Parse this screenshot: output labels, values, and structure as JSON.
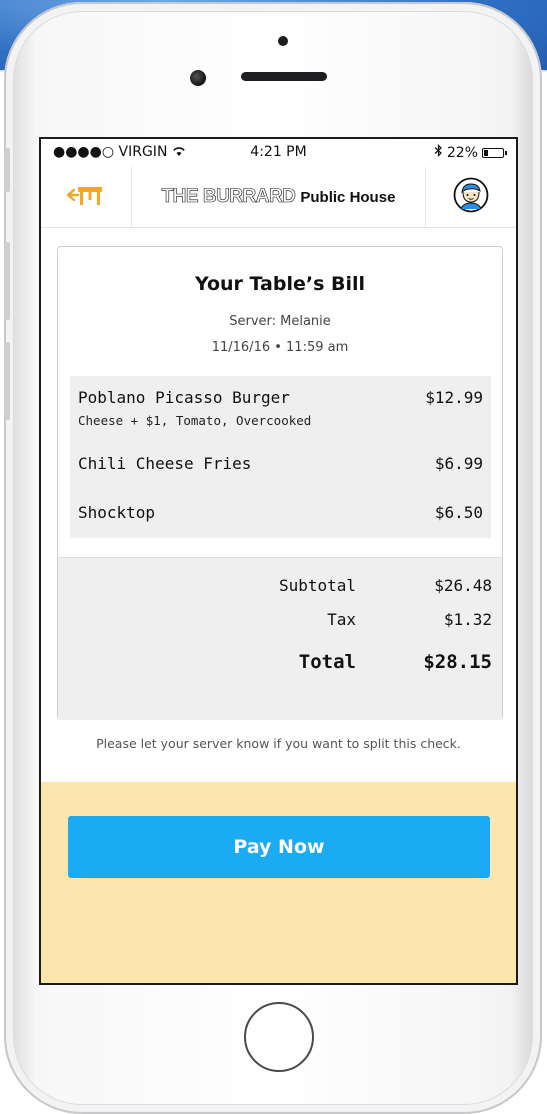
{
  "status_bar": {
    "carrier": "●●●●○ VIRGIN",
    "time": "4:21 PM",
    "battery": "22%",
    "battery_level": 0.22
  },
  "nav": {
    "brand_main": "THE BURRARD",
    "brand_sub": "Public House",
    "back_icon": "table-back-icon",
    "avatar_icon": "user-avatar-icon"
  },
  "bill": {
    "title": "Your Table’s Bill",
    "server": "Server: Melanie",
    "datetime": "11/16/16 • 11:59 am",
    "items": [
      {
        "name": "Poblano Picasso Burger",
        "price": "$12.99",
        "mods": "Cheese + $1, Tomato, Overcooked"
      },
      {
        "name": "Chili Cheese Fries",
        "price": "$6.99",
        "mods": ""
      },
      {
        "name": "Shocktop",
        "price": "$6.50",
        "mods": ""
      }
    ],
    "subtotal_label": "Subtotal",
    "subtotal": "$26.48",
    "tax_label": "Tax",
    "tax": "$1.32",
    "total_label": "Total",
    "total": "$28.15"
  },
  "split_note": "Please let your server know if you want to split this check.",
  "pay_button_label": "Pay Now",
  "colors": {
    "accent_orange": "#f5a623",
    "pay_blue": "#1aabf3",
    "pay_area_bg": "#fde6ad"
  }
}
